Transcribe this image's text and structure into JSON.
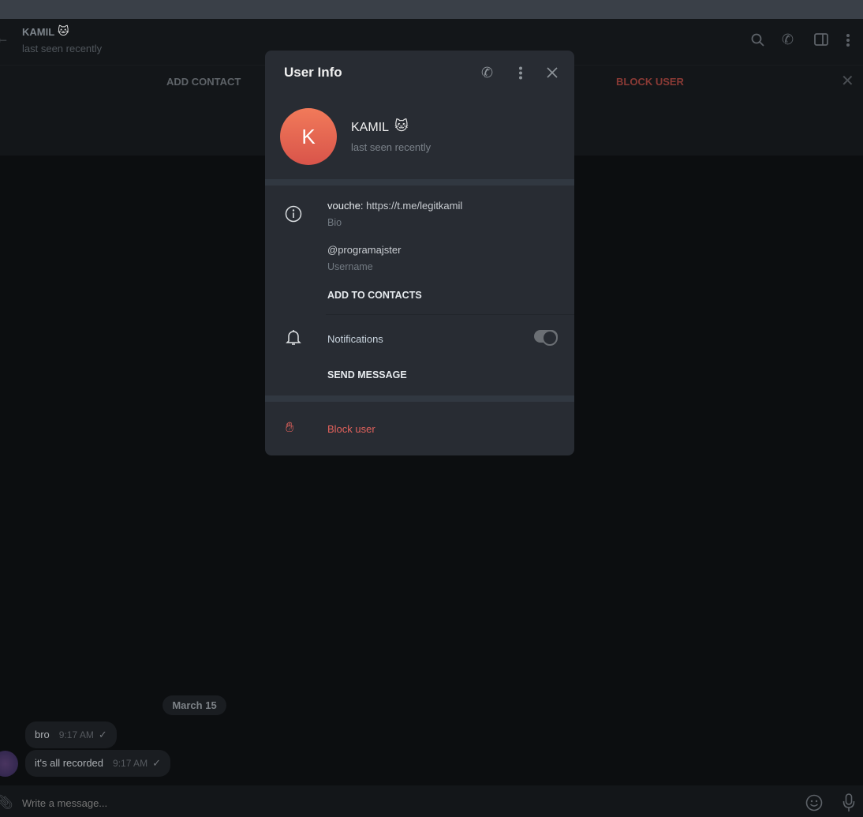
{
  "header": {
    "name": "KAMIL",
    "status": "last seen recently"
  },
  "actionbar": {
    "add_contact": "ADD CONTACT",
    "block_user": "BLOCK USER"
  },
  "chat": {
    "date": "March 15",
    "messages": [
      {
        "text": "bro",
        "time": "9:17 AM"
      },
      {
        "text": "it's all recorded",
        "time": "9:17 AM"
      }
    ],
    "input_placeholder": "Write a message..."
  },
  "modal": {
    "title": "User Info",
    "avatar_letter": "K",
    "name": "KAMIL",
    "status": "last seen recently",
    "bio_prefix": "vouche:",
    "bio_link": "https://t.me/legitkamil",
    "bio_label": "Bio",
    "username": "@programajster",
    "username_label": "Username",
    "add_to_contacts": "ADD TO CONTACTS",
    "notifications": "Notifications",
    "notifications_on": true,
    "send_message": "SEND MESSAGE",
    "block_user": "Block user"
  },
  "colors": {
    "danger": "#e2625c",
    "avatar": "#e2654f",
    "accent_dim_red": "#8a3a35"
  }
}
